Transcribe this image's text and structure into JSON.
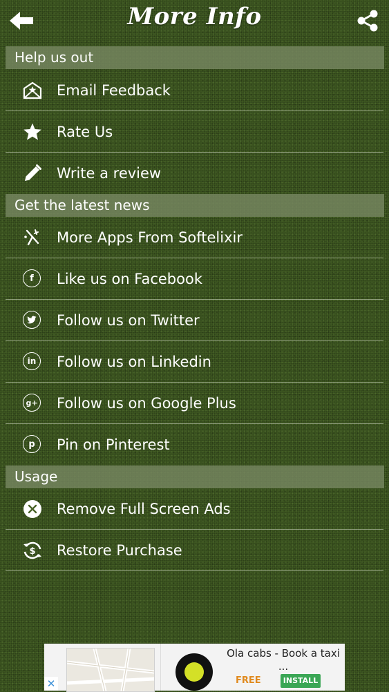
{
  "header": {
    "title": "More Info",
    "back_icon": "back-arrow-icon",
    "share_icon": "share-icon"
  },
  "sections": [
    {
      "title": "Help us out",
      "items": [
        {
          "label": "Email Feedback",
          "icon": "email-feedback-icon"
        },
        {
          "label": "Rate Us",
          "icon": "star-icon"
        },
        {
          "label": "Write a review",
          "icon": "pencil-icon"
        }
      ]
    },
    {
      "title": "Get the latest news",
      "items": [
        {
          "label": "More Apps From Softelixir",
          "icon": "softelixir-icon"
        },
        {
          "label": "Like us on Facebook",
          "icon": "facebook-icon"
        },
        {
          "label": "Follow us on Twitter",
          "icon": "twitter-icon"
        },
        {
          "label": "Follow us on Linkedin",
          "icon": "linkedin-icon"
        },
        {
          "label": "Follow us on Google Plus",
          "icon": "google-plus-icon"
        },
        {
          "label": "Pin on Pinterest",
          "icon": "pinterest-icon"
        }
      ]
    },
    {
      "title": "Usage",
      "items": [
        {
          "label": "Remove Full Screen Ads",
          "icon": "close-circle-icon"
        },
        {
          "label": "Restore Purchase",
          "icon": "restore-dollar-icon"
        }
      ]
    }
  ],
  "ad": {
    "title": "Ola cabs - Book a taxi ...",
    "price": "FREE",
    "install_label": "INSTALL",
    "close_icon": "ad-close-icon"
  },
  "colors": {
    "background": "#3f5a22",
    "section_header": "#768660",
    "install": "#3aa655",
    "free": "#e08a1e"
  }
}
